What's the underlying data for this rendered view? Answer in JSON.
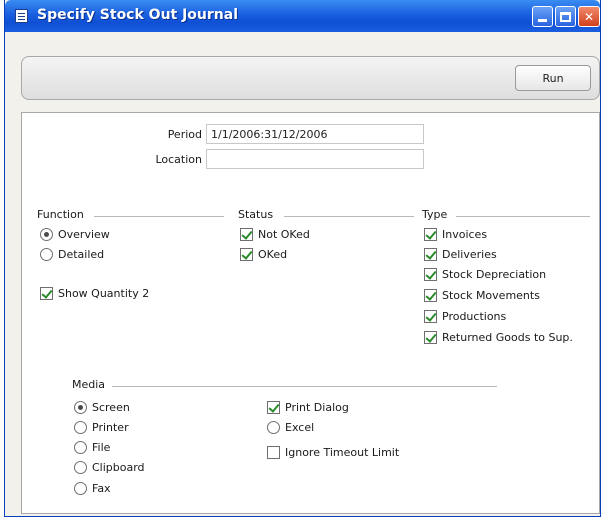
{
  "window": {
    "title": "Specify Stock Out Journal"
  },
  "toolbar": {
    "run_label": "Run"
  },
  "fields": {
    "period_label": "Period",
    "period_value": "1/1/2006:31/12/2006",
    "location_label": "Location",
    "location_value": ""
  },
  "function": {
    "title": "Function",
    "options": [
      "Overview",
      "Detailed"
    ],
    "selected": "Overview"
  },
  "show_quantity2": {
    "label": "Show Quantity 2",
    "checked": true
  },
  "status": {
    "title": "Status",
    "options": [
      {
        "label": "Not OKed",
        "checked": true
      },
      {
        "label": "OKed",
        "checked": true
      }
    ]
  },
  "type": {
    "title": "Type",
    "options": [
      {
        "label": "Invoices",
        "checked": true
      },
      {
        "label": "Deliveries",
        "checked": true
      },
      {
        "label": "Stock Depreciation",
        "checked": true
      },
      {
        "label": "Stock Movements",
        "checked": true
      },
      {
        "label": "Productions",
        "checked": true
      },
      {
        "label": "Returned Goods to Sup.",
        "checked": true
      }
    ]
  },
  "media": {
    "title": "Media",
    "options": [
      "Screen",
      "Printer",
      "File",
      "Clipboard",
      "Fax"
    ],
    "selected": "Screen"
  },
  "extra_options": {
    "print_dialog": {
      "label": "Print Dialog",
      "checked": true
    },
    "excel": {
      "label": "Excel",
      "checked": false
    },
    "ignore_timeout": {
      "label": "Ignore Timeout Limit",
      "checked": false
    }
  }
}
